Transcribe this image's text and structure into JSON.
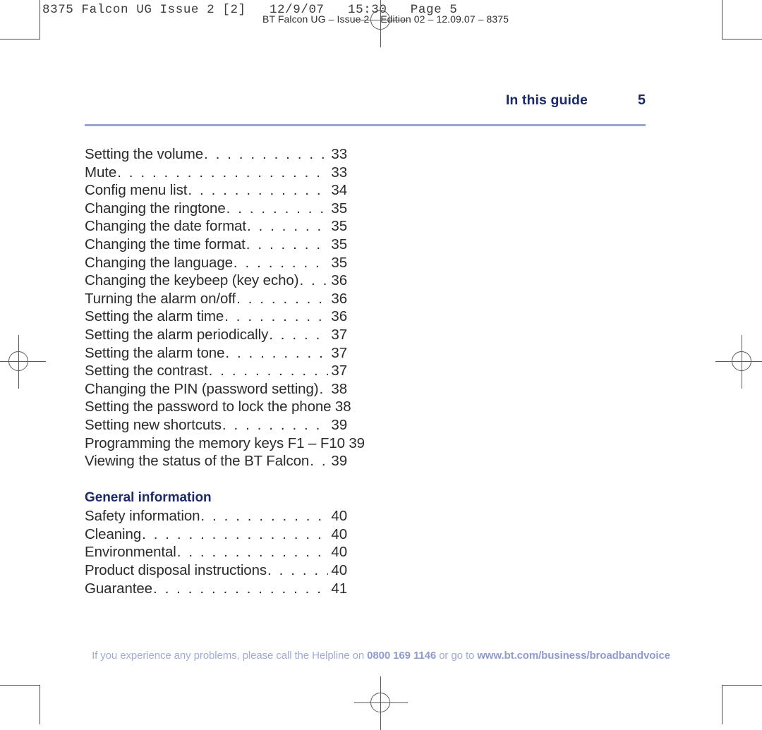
{
  "prepress": {
    "job_slug": "8375 Falcon UG Issue 2 [2]   12/9/07   15:30   Page 5",
    "doc_slug": "BT Falcon UG – Issue 2 – Edition 02 – 12.09.07 – 8375"
  },
  "running_head": {
    "label": "In this guide",
    "folio": "5"
  },
  "toc": {
    "groups": [
      {
        "title": null,
        "entries": [
          {
            "title": "Setting the volume",
            "page": "33"
          },
          {
            "title": "Mute",
            "page": "33"
          },
          {
            "title": "Config menu list",
            "page": "34"
          },
          {
            "title": "Changing the ringtone",
            "page": "35"
          },
          {
            "title": "Changing the date format",
            "page": "35"
          },
          {
            "title": "Changing the time format",
            "page": "35"
          },
          {
            "title": "Changing the language",
            "page": "35"
          },
          {
            "title": "Changing the keybeep (key echo)",
            "page": "36"
          },
          {
            "title": "Turning the alarm on/off",
            "page": "36"
          },
          {
            "title": "Setting the alarm time",
            "page": "36"
          },
          {
            "title": "Setting the alarm periodically",
            "page": "37"
          },
          {
            "title": "Setting the alarm tone",
            "page": "37"
          },
          {
            "title": "Setting the contrast",
            "page": "37"
          },
          {
            "title": "Changing the PIN (password setting)",
            "page": "38"
          },
          {
            "title": "Setting the password to lock the phone",
            "page": "38"
          },
          {
            "title": "Setting new shortcuts",
            "page": "39"
          },
          {
            "title": "Programming the memory keys F1 – F10",
            "page": "39"
          },
          {
            "title": "Viewing the status of the BT Falcon",
            "page": "39"
          }
        ]
      },
      {
        "title": "General information",
        "entries": [
          {
            "title": "Safety information",
            "page": "40"
          },
          {
            "title": "Cleaning",
            "page": "40"
          },
          {
            "title": "Environmental",
            "page": "40"
          },
          {
            "title": "Product disposal instructions",
            "page": "40"
          },
          {
            "title": "Guarantee",
            "page": "41"
          }
        ]
      }
    ]
  },
  "footer": {
    "lead": "If you experience any problems, please call the Helpline on ",
    "phone": "0800 169 1146",
    "middle": " or go to ",
    "url": "www.bt.com/business/broadbandvoice"
  }
}
